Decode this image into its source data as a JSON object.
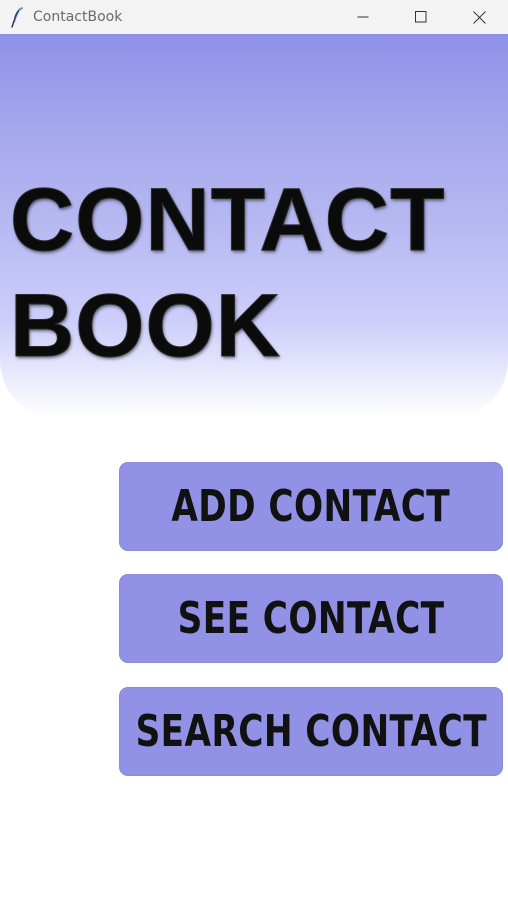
{
  "window": {
    "title": "ContactBook",
    "app_icon": "feather-icon",
    "controls": [
      "minimize-icon",
      "maximize-icon",
      "close-icon"
    ]
  },
  "header": {
    "title_line1": "CONTACT",
    "title_line2": "BOOK",
    "gradient_top": "#8e91e8",
    "gradient_bottom": "#ffffff"
  },
  "actions": {
    "add_label": "ADD CONTACT",
    "see_label": "SEE CONTACT",
    "search_label": "SEARCH CONTACT",
    "button_color": "#9191e6"
  }
}
